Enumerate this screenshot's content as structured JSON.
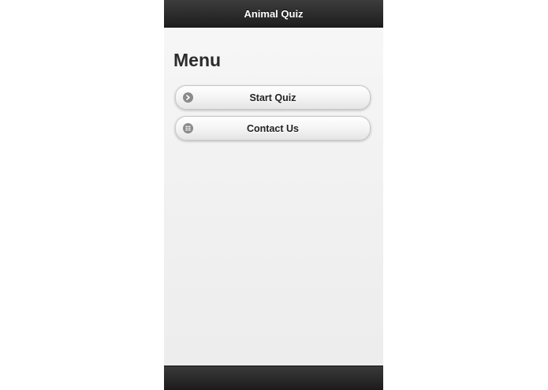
{
  "header": {
    "title": "Animal Quiz"
  },
  "page": {
    "title": "Menu"
  },
  "menu": {
    "items": [
      {
        "label": "Start Quiz",
        "icon": "arrow-right-icon"
      },
      {
        "label": "Contact Us",
        "icon": "grid-icon"
      }
    ]
  },
  "colors": {
    "header_bg": "#262626",
    "footer_bg": "#262626",
    "page_bg": "#f1f1f1",
    "icon_bg": "#8a8a8a"
  }
}
